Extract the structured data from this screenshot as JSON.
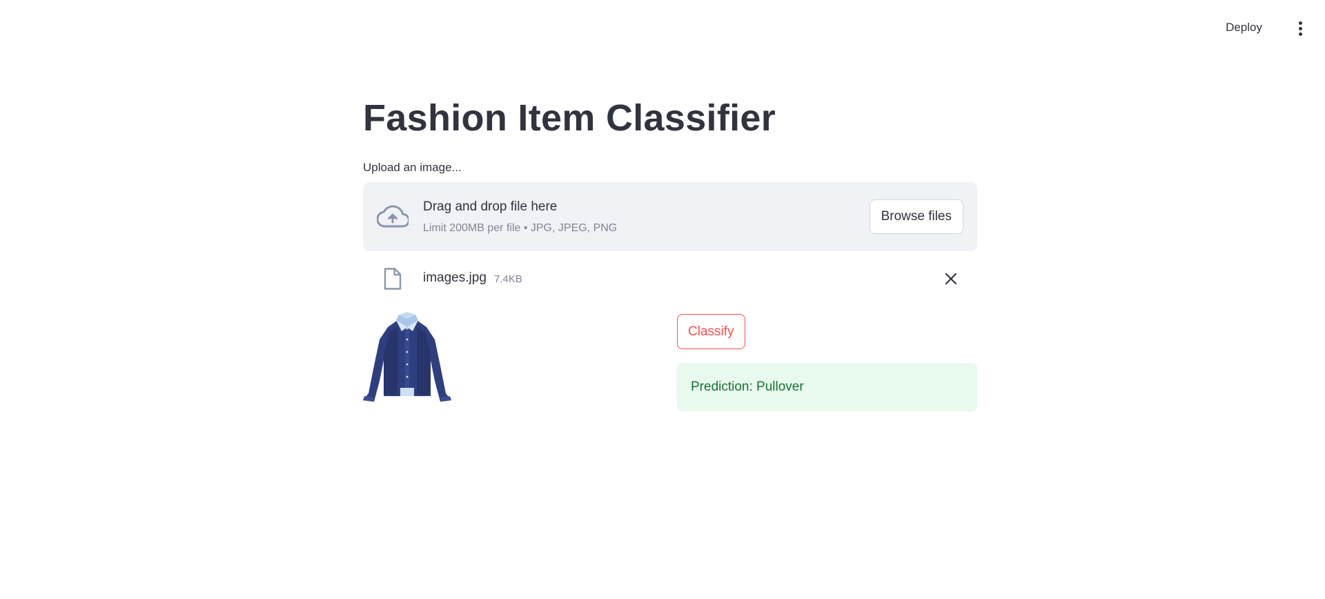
{
  "header": {
    "deploy_label": "Deploy",
    "menu_icon": "more-vert-icon"
  },
  "main": {
    "title": "Fashion Item Classifier",
    "uploader": {
      "label": "Upload an image...",
      "dropzone_title": "Drag and drop file here",
      "dropzone_limit": "Limit 200MB per file • JPG, JPEG, PNG",
      "browse_label": "Browse files",
      "icon": "cloud-upload-icon"
    },
    "uploaded_file": {
      "name": "images.jpg",
      "size": "7.4KB",
      "icon": "file-icon",
      "remove_icon": "close-icon"
    },
    "preview_image": "blue-dress-shirt",
    "classify_label": "Classify",
    "prediction_text": "Prediction: Pullover"
  },
  "colors": {
    "accent": "#ff4b4b",
    "success_bg": "#e8f9ee",
    "success_text": "#177233",
    "dropzone_bg": "#f0f2f6",
    "text": "#31333f"
  }
}
